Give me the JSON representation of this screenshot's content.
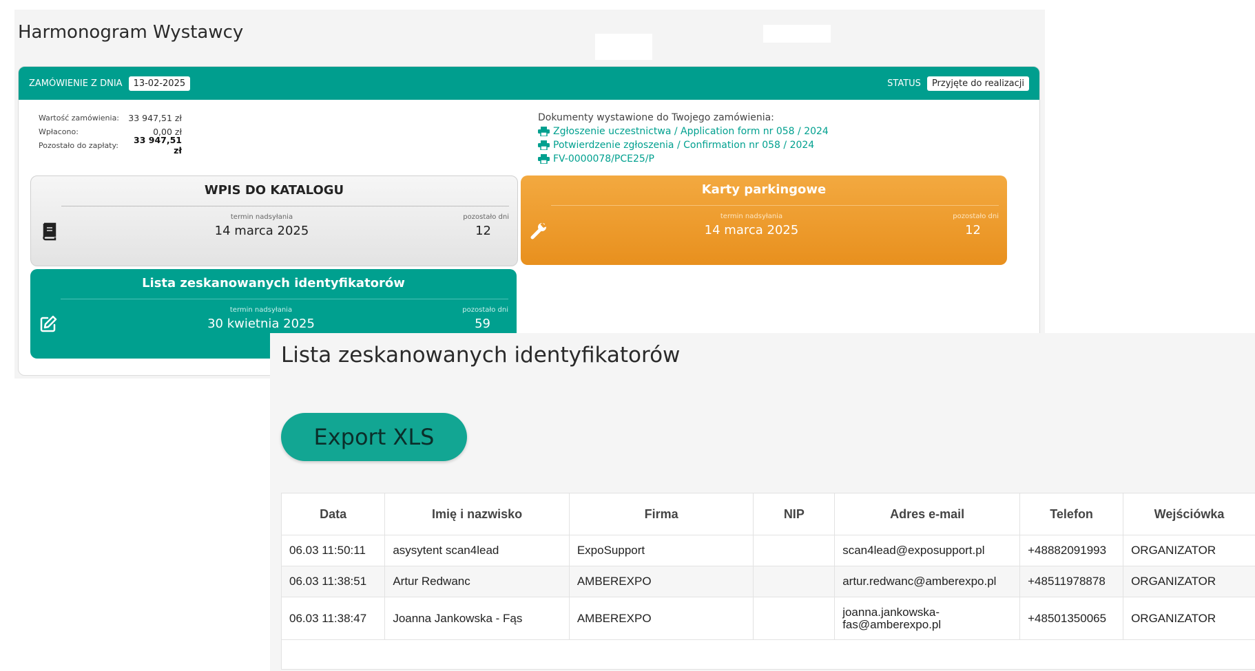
{
  "harmonogram": {
    "title": "Harmonogram Wystawcy",
    "order": {
      "date_label": "ZAMÓWIENIE Z DNIA",
      "date": "13-02-2025",
      "status_label": "STATUS",
      "status": "Przyjęte do realizacji",
      "totals": [
        {
          "label": "Wartość zamówienia:",
          "value": "33 947,51 zł"
        },
        {
          "label": "Wpłacono:",
          "value": "0,00 zł"
        },
        {
          "label": "Pozostało do zapłaty:",
          "value": "33 947,51 zł"
        }
      ],
      "documents_header": "Dokumenty wystawione do Twojego zamówienia:",
      "documents": [
        "Zgłoszenie uczestnictwa / Application form nr 058 / 2024",
        "Potwierdzenie zgłoszenia / Confirmation nr 058 / 2024",
        "FV-0000078/PCE25/P"
      ]
    },
    "tiles": [
      {
        "title": "WPIS DO KATALOGU",
        "deadline_label": "termin nadsyłania",
        "deadline": "14 marca 2025",
        "days_label": "pozostało dni",
        "days": "12",
        "icon": "book-icon",
        "color": "#e6e6e6"
      },
      {
        "title": "Karty parkingowe",
        "deadline_label": "termin nadsyłania",
        "deadline": "14 marca 2025",
        "days_label": "pozostało dni",
        "days": "12",
        "icon": "wrench-icon",
        "color": "#ed9a2c"
      },
      {
        "title": "Lista zeskanowanych identyfikatorów",
        "deadline_label": "termin nadsyłania",
        "deadline": "30 kwietnia 2025",
        "days_label": "pozostało dni",
        "days": "59",
        "icon": "edit-icon",
        "color": "#00a08f"
      }
    ]
  },
  "scan_list": {
    "title": "Lista zeskanowanych identyfikatorów",
    "export_label": "Export XLS",
    "columns": [
      "Data",
      "Imię i nazwisko",
      "Firma",
      "NIP",
      "Adres e-mail",
      "Telefon",
      "Wejściówka"
    ],
    "rows": [
      {
        "data": "06.03 11:50:11",
        "name": "asysytent scan4lead",
        "firma": "ExpoSupport",
        "nip": "",
        "email": "scan4lead@exposupport.pl",
        "telefon": "+48882091993",
        "wejsciowka": "ORGANIZATOR"
      },
      {
        "data": "06.03 11:38:51",
        "name": "Artur Redwanc",
        "firma": "AMBEREXPO",
        "nip": "",
        "email": "artur.redwanc@amberexpo.pl",
        "telefon": "+48511978878",
        "wejsciowka": "ORGANIZATOR"
      },
      {
        "data": "06.03 11:38:47",
        "name": "Joanna Jankowska - Fąs",
        "firma": "AMBEREXPO",
        "nip": "",
        "email": "joanna.jankowska-fas@amberexpo.pl",
        "telefon": "+48501350065",
        "wejsciowka": "ORGANIZATOR"
      }
    ]
  },
  "colors": {
    "accent": "#009e8e",
    "orange": "#ed9a2c",
    "link": "#00a08f"
  }
}
